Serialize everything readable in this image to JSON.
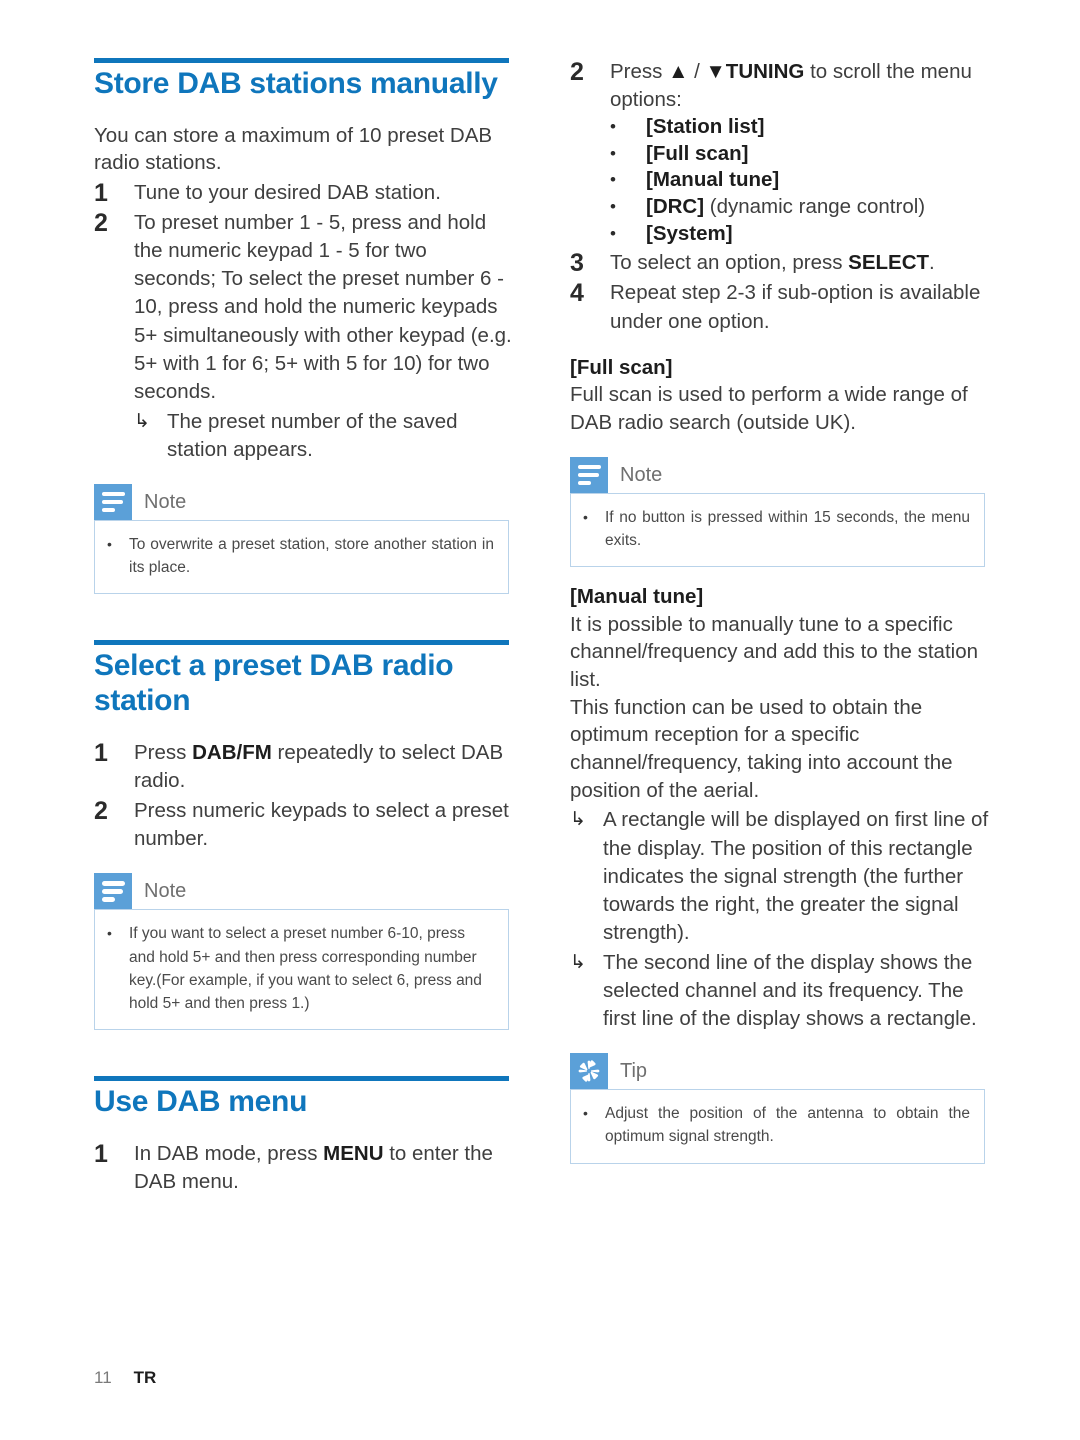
{
  "document": {
    "footer": {
      "page_number": "11",
      "language_code": "TR"
    }
  },
  "colors": {
    "heading_blue": "#0f76bc",
    "callout_icon_blue": "#5ba0d8",
    "callout_border": "#b9d3ea",
    "body_text": "#3f3f3f"
  },
  "left_column": {
    "section_store": {
      "title": "Store DAB stations manually",
      "intro": "You can store a maximum of 10 preset DAB radio stations.",
      "steps": [
        {
          "number": "1",
          "text": "Tune to your desired DAB station."
        },
        {
          "number": "2",
          "text": "To preset number 1 - 5, press and hold the numeric keypad 1 - 5 for two seconds; To select the preset number 6 - 10, press and hold the numeric keypads 5+ simultaneously with other keypad (e.g. 5+ with 1 for 6; 5+ with 5 for 10) for two seconds.",
          "result_arrow": "↳",
          "result": "The preset number of the saved station appears."
        }
      ],
      "note": {
        "icon": "note-lines-icon",
        "label": "Note",
        "bullet": "•",
        "text": "To overwrite a preset station, store another station in its place."
      }
    },
    "section_select": {
      "title": "Select a preset DAB radio station",
      "steps": [
        {
          "number": "1",
          "text_before": "Press ",
          "bold": "DAB/FM",
          "text_after": " repeatedly to select DAB radio."
        },
        {
          "number": "2",
          "text": "Press numeric keypads to select a preset number."
        }
      ],
      "note": {
        "icon": "note-lines-icon",
        "label": "Note",
        "bullet": "•",
        "text": "If you want to select a preset number 6-10, press and hold 5+ and then press corresponding number key.(For example, if you want to select 6, press and hold 5+ and then press 1.)"
      }
    },
    "section_menu": {
      "title": "Use DAB menu",
      "steps": [
        {
          "number": "1",
          "text_before": "In DAB mode, press ",
          "bold": "MENU",
          "text_after": " to enter the DAB menu."
        }
      ]
    }
  },
  "right_column": {
    "step2": {
      "number": "2",
      "text_before": "Press ",
      "arrow_up": "▲",
      "separator": " / ",
      "arrow_down": "▼",
      "bold": "TUNING",
      "text_after": " to scroll the menu options:",
      "options": [
        {
          "bullet": "•",
          "key": "[Station list]",
          "desc": ""
        },
        {
          "bullet": "•",
          "key": "[Full scan]",
          "desc": ""
        },
        {
          "bullet": "•",
          "key": "[Manual tune]",
          "desc": ""
        },
        {
          "bullet": "•",
          "key": "[DRC]",
          "desc": " (dynamic range control)"
        },
        {
          "bullet": "•",
          "key": "[System]",
          "desc": ""
        }
      ]
    },
    "step3": {
      "number": "3",
      "text_before": "To select an option, press ",
      "bold": "SELECT",
      "text_after": "."
    },
    "step4": {
      "number": "4",
      "text": "Repeat step 2-3 if sub-option is available under one option."
    },
    "full_scan": {
      "heading": "[Full scan]",
      "body": "Full scan is used to perform a wide range of DAB radio search (outside UK)."
    },
    "note": {
      "icon": "note-lines-icon",
      "label": "Note",
      "bullet": "•",
      "text": "If no button is pressed within 15 seconds, the menu exits."
    },
    "manual_tune": {
      "heading": "[Manual tune]",
      "para1": "It is possible to manually tune to a specific channel/frequency and add this to the station list.",
      "para2": "This function can be used to obtain the optimum reception for a specific channel/frequency, taking into account the position of the aerial.",
      "arrows": [
        {
          "glyph": "↳",
          "text": "A rectangle will be displayed on first line of the display. The position of this rectangle indicates the signal strength (the further towards the right, the greater the signal strength)."
        },
        {
          "glyph": "↳",
          "text": "The second line of the display shows the selected channel and its frequency. The first line of the display shows a rectangle."
        }
      ]
    },
    "tip": {
      "icon": "tip-star-icon",
      "label": "Tip",
      "bullet": "•",
      "text": "Adjust the position of the antenna to obtain the optimum signal strength."
    }
  }
}
